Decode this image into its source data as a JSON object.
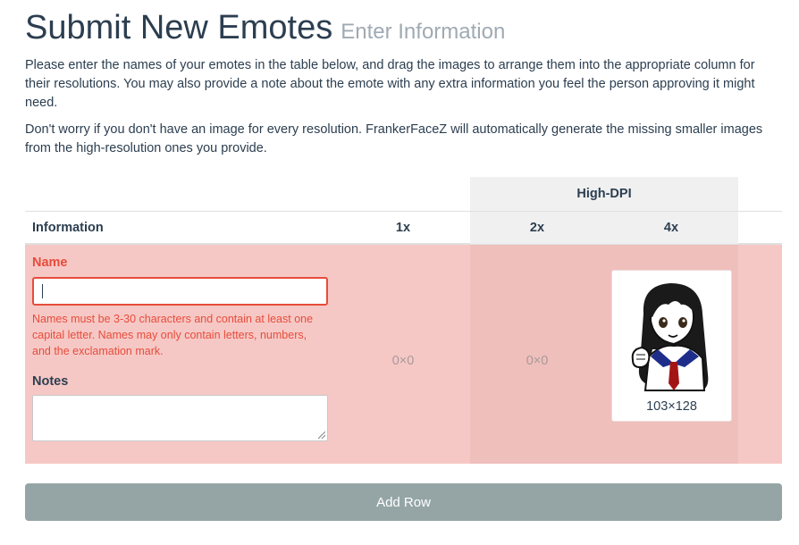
{
  "header": {
    "title": "Submit New Emotes",
    "subtitle": "Enter Information"
  },
  "intro": {
    "paragraph1": "Please enter the names of your emotes in the table below, and drag the images to arrange them into the appropriate column for their resolutions. You may also provide a note about the emote with any extra information you feel the person approving it might need.",
    "paragraph2": "Don't worry if you don't have an image for every resolution. FrankerFaceZ will automatically generate the missing smaller images from the high-resolution ones you provide."
  },
  "table": {
    "group_header": "High-DPI",
    "columns": [
      "Information",
      "1x",
      "2x",
      "4x"
    ],
    "row": {
      "name_label": "Name",
      "name_value": "",
      "name_error": "Names must be 3-30 characters and contain at least one capital letter. Names may only contain letters, numbers, and the exclamation mark.",
      "notes_label": "Notes",
      "notes_value": "",
      "slot_1x": "0×0",
      "slot_2x": "0×0",
      "slot_4x_dimensions": "103×128"
    }
  },
  "actions": {
    "add_row": "Add Row"
  },
  "colors": {
    "error": "#e74c3c",
    "row_error_bg": "#f6c8c5",
    "button_bg": "#95a5a6",
    "text": "#2c3e50"
  },
  "icons": {
    "emote_image": "anime-girl-emote-image"
  }
}
